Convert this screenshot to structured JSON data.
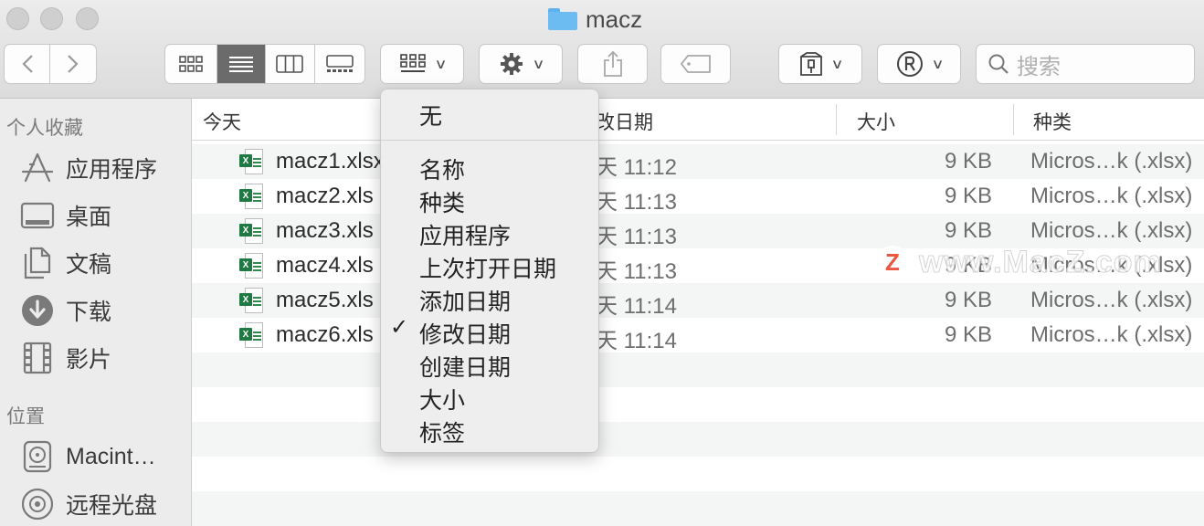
{
  "window": {
    "title": "macz"
  },
  "search": {
    "placeholder": "搜索"
  },
  "sidebar": {
    "favorites_header": "个人收藏",
    "favorites": [
      {
        "label": "应用程序",
        "icon": "applications-icon"
      },
      {
        "label": "桌面",
        "icon": "desktop-icon"
      },
      {
        "label": "文稿",
        "icon": "documents-icon"
      },
      {
        "label": "下载",
        "icon": "downloads-icon"
      },
      {
        "label": "影片",
        "icon": "movies-icon"
      }
    ],
    "locations_header": "位置",
    "locations": [
      {
        "label": "Macint…",
        "icon": "hard-drive-icon"
      },
      {
        "label": "远程光盘",
        "icon": "remote-disc-icon"
      }
    ]
  },
  "columns": {
    "group": "今天",
    "date": "改日期",
    "size": "大小",
    "kind": "种类"
  },
  "files": [
    {
      "name": "macz1.xlsx",
      "date": "天 11:12",
      "size": "9 KB",
      "kind": "Micros…k (.xlsx)"
    },
    {
      "name": "macz2.xls",
      "date": "天 11:13",
      "size": "9 KB",
      "kind": "Micros…k (.xlsx)"
    },
    {
      "name": "macz3.xls",
      "date": "天 11:13",
      "size": "9 KB",
      "kind": "Micros…k (.xlsx)"
    },
    {
      "name": "macz4.xls",
      "date": "天 11:13",
      "size": "9 KB",
      "kind": "Micros…k (.xlsx)"
    },
    {
      "name": "macz5.xls",
      "date": "天 11:14",
      "size": "9 KB",
      "kind": "Micros…k (.xlsx)"
    },
    {
      "name": "macz6.xls",
      "date": "天 11:14",
      "size": "9 KB",
      "kind": "Micros…k (.xlsx)"
    }
  ],
  "group_menu": {
    "none": "无",
    "items": [
      "名称",
      "种类",
      "应用程序",
      "上次打开日期",
      "添加日期",
      "修改日期",
      "创建日期",
      "大小",
      "标签"
    ],
    "checked": "修改日期"
  },
  "watermark": {
    "logo": "Z",
    "text": "www.MacZ.com"
  },
  "colors": {
    "folder": "#6cbcf1",
    "excel": "#1e7a42",
    "watermark_logo": "#e8452c",
    "active_segment": "#6b6b6b"
  }
}
